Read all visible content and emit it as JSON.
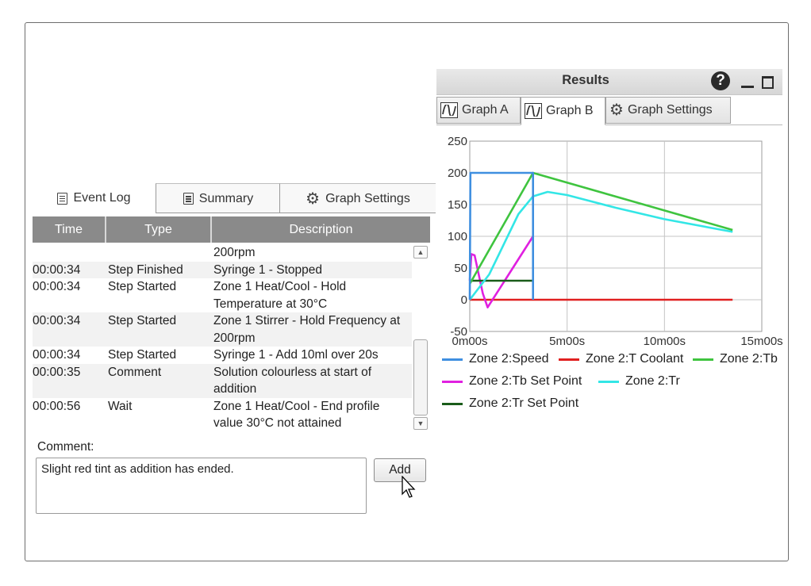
{
  "left_tabs": [
    {
      "label": "Event Log",
      "icon": "document-icon",
      "active": true
    },
    {
      "label": "Summary",
      "icon": "document-icon",
      "active": false
    },
    {
      "label": "Graph Settings",
      "icon": "gear-icon",
      "active": false
    }
  ],
  "event_log": {
    "columns": [
      "Time",
      "Type",
      "Description"
    ],
    "rows": [
      {
        "time": "",
        "type": "",
        "description": "200rpm"
      },
      {
        "time": "00:00:34",
        "type": "Step Finished",
        "description": "Syringe 1 - Stopped"
      },
      {
        "time": "00:00:34",
        "type": "Step Started",
        "description": "Zone 1 Heat/Cool - Hold Temperature at 30°C"
      },
      {
        "time": "00:00:34",
        "type": "Step Started",
        "description": "Zone 1 Stirrer - Hold Frequency at 200rpm"
      },
      {
        "time": "00:00:34",
        "type": "Step Started",
        "description": "Syringe 1 - Add 10ml over 20s"
      },
      {
        "time": "00:00:35",
        "type": "Comment",
        "description": "Solution colourless at start of addition"
      },
      {
        "time": "00:00:56",
        "type": "Wait",
        "description": "Zone 1 Heat/Cool - End profile value 30°C not attained"
      }
    ]
  },
  "comment": {
    "label": "Comment:",
    "value": "Slight red tint as addition has ended.",
    "add_label": "Add"
  },
  "results": {
    "title": "Results",
    "tabs": [
      {
        "label": "Graph A",
        "icon": "waveform-icon",
        "active": false
      },
      {
        "label": "Graph B",
        "icon": "waveform-icon",
        "active": true
      },
      {
        "label": "Graph Settings",
        "icon": "gear-icon",
        "active": false
      }
    ]
  },
  "chart_data": {
    "type": "line",
    "x_ticks": [
      "0m00s",
      "5m00s",
      "10m00s",
      "15m00s"
    ],
    "y_ticks": [
      "250",
      "200",
      "150",
      "100",
      "50",
      "0",
      "-50"
    ],
    "ylim": [
      -50,
      250
    ],
    "xlim_seconds": [
      0,
      900
    ],
    "grid": true,
    "legend_position": "bottom",
    "series": [
      {
        "name": "Zone 2:Speed",
        "color": "#3f8fe0",
        "points": [
          [
            0,
            0
          ],
          [
            2,
            200
          ],
          [
            195,
            200
          ],
          [
            195,
            0
          ]
        ]
      },
      {
        "name": "Zone 2:T Coolant",
        "color": "#e02020",
        "points": [
          [
            0,
            0
          ],
          [
            810,
            0
          ]
        ]
      },
      {
        "name": "Zone 2:Tb",
        "color": "#3fc43f",
        "points": [
          [
            0,
            25
          ],
          [
            195,
            200
          ],
          [
            810,
            110
          ]
        ]
      },
      {
        "name": "Zone 2:Tb Set Point",
        "color": "#e020e0",
        "points": [
          [
            0,
            30
          ],
          [
            5,
            72
          ],
          [
            15,
            70
          ],
          [
            40,
            10
          ],
          [
            55,
            -12
          ],
          [
            120,
            40
          ],
          [
            195,
            100
          ]
        ]
      },
      {
        "name": "Zone 2:Tr",
        "color": "#33e6e6",
        "points": [
          [
            0,
            0
          ],
          [
            60,
            40
          ],
          [
            150,
            135
          ],
          [
            195,
            163
          ],
          [
            240,
            170
          ],
          [
            300,
            165
          ],
          [
            450,
            145
          ],
          [
            600,
            127
          ],
          [
            810,
            107
          ]
        ]
      },
      {
        "name": "Zone 2:Tr Set Point",
        "color": "#1a5c1a",
        "points": [
          [
            0,
            30
          ],
          [
            195,
            30
          ]
        ]
      }
    ]
  }
}
